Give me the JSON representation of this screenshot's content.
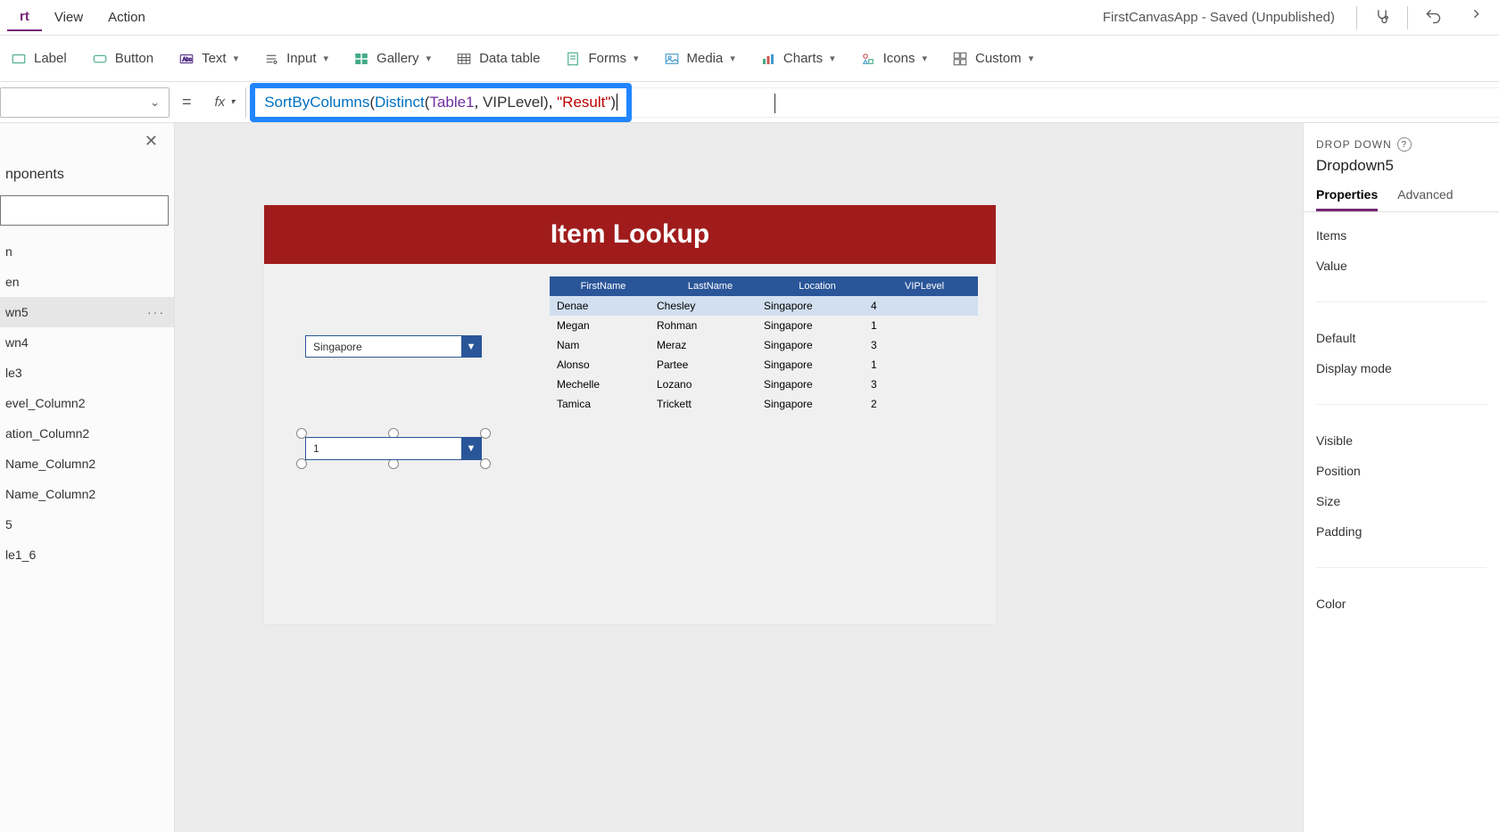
{
  "topmenu": {
    "items": [
      "rt",
      "View",
      "Action"
    ],
    "active_index": 0
  },
  "app_status": "FirstCanvasApp - Saved (Unpublished)",
  "ribbon": {
    "label": "Label",
    "button": "Button",
    "text": "Text",
    "input": "Input",
    "gallery": "Gallery",
    "datatable": "Data table",
    "forms": "Forms",
    "media": "Media",
    "charts": "Charts",
    "icons": "Icons",
    "custom": "Custom"
  },
  "formula": {
    "equals": "=",
    "fx": "fx",
    "parts": {
      "fn1": "SortByColumns",
      "p1": "(",
      "fn2": "Distinct",
      "p2": "(",
      "tbl": "Table1",
      "comma1": ", ",
      "col": "VIPLevel",
      "p3": ")",
      "comma2": ", ",
      "str": "\"Result\"",
      "p4": ")"
    }
  },
  "tree": {
    "close": "✕",
    "title": "nponents",
    "nodes": [
      "n",
      "en",
      "wn5",
      "wn4",
      "le3",
      "evel_Column2",
      "ation_Column2",
      "Name_Column2",
      "Name_Column2",
      "5",
      "le1_6"
    ],
    "selected_index": 2,
    "more": "···"
  },
  "canvas": {
    "header_title": "Item Lookup",
    "dropdown1_value": "Singapore",
    "dropdown2_value": "1",
    "table": {
      "columns": [
        "FirstName",
        "LastName",
        "Location",
        "VIPLevel"
      ],
      "rows": [
        [
          "Denae",
          "Chesley",
          "Singapore",
          "4"
        ],
        [
          "Megan",
          "Rohman",
          "Singapore",
          "1"
        ],
        [
          "Nam",
          "Meraz",
          "Singapore",
          "3"
        ],
        [
          "Alonso",
          "Partee",
          "Singapore",
          "1"
        ],
        [
          "Mechelle",
          "Lozano",
          "Singapore",
          "3"
        ],
        [
          "Tamica",
          "Trickett",
          "Singapore",
          "2"
        ]
      ],
      "selected_row": 0
    }
  },
  "props": {
    "pane_title": "DROP DOWN",
    "help": "?",
    "control_name": "Dropdown5",
    "tabs": [
      "Properties",
      "Advanced"
    ],
    "active_tab": 0,
    "rows": [
      "Items",
      "Value",
      "Default",
      "Display mode",
      "Visible",
      "Position",
      "Size",
      "Padding",
      "Color"
    ]
  }
}
